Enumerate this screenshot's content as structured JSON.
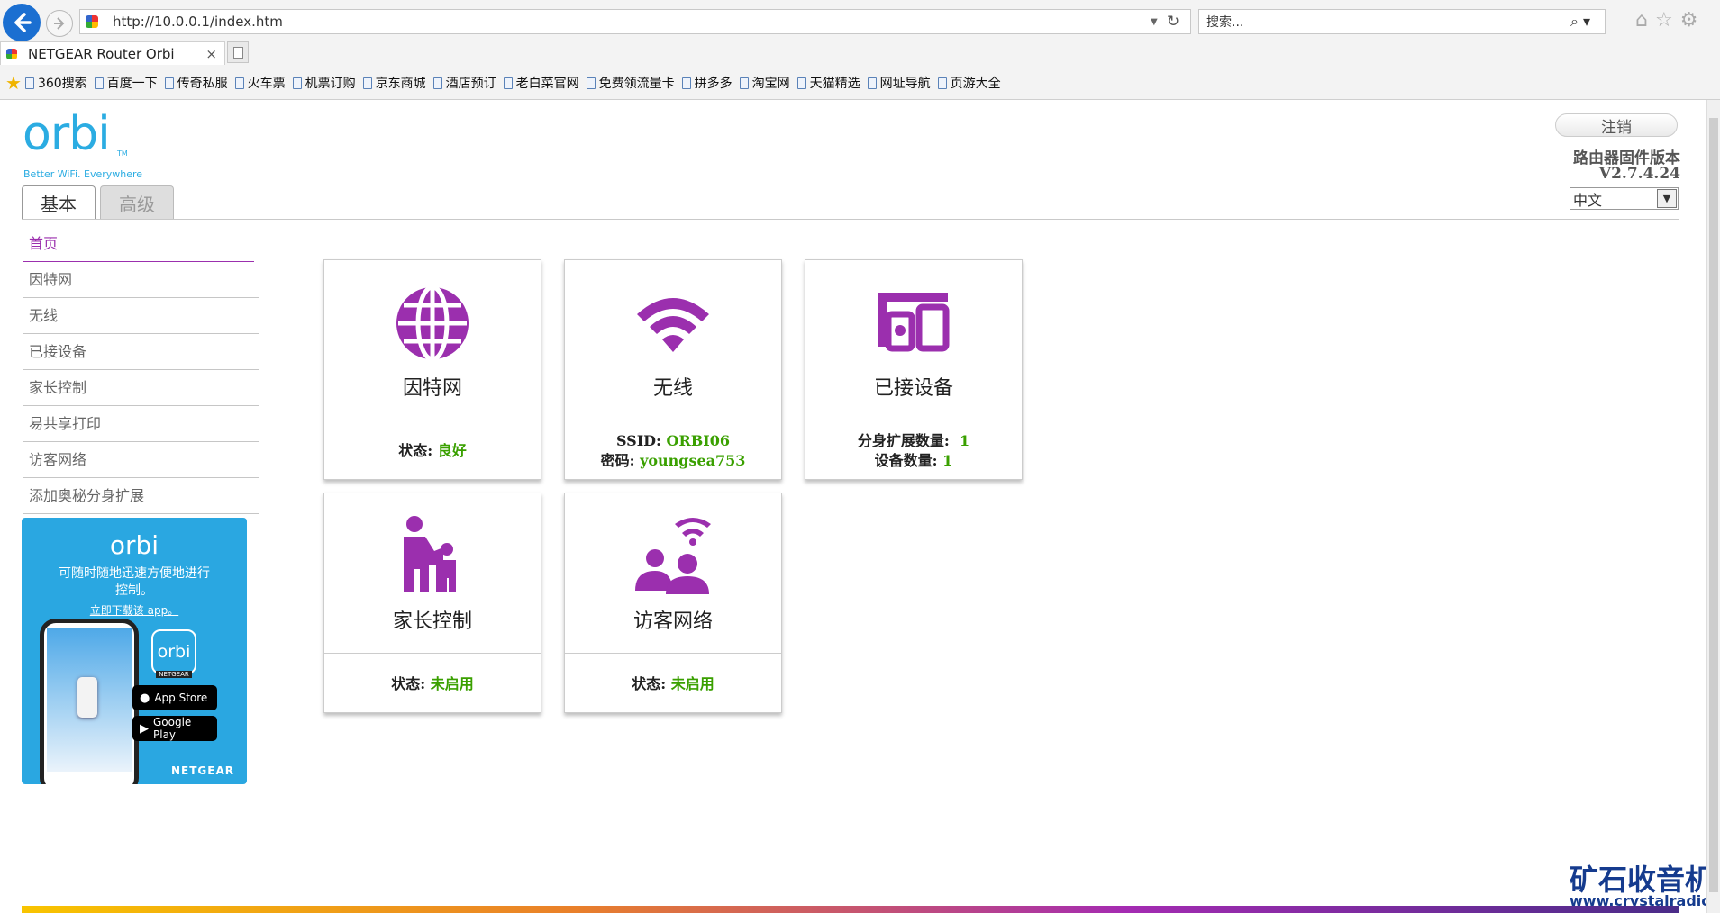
{
  "browser": {
    "url": "http://10.0.0.1/index.htm",
    "search_placeholder": "搜索...",
    "tab_title": "NETGEAR Router Orbi",
    "bookmarks": [
      "360搜索",
      "百度一下",
      "传奇私服",
      "火车票",
      "机票订购",
      "京东商城",
      "酒店预订",
      "老白菜官网",
      "免费领流量卡",
      "拼多多",
      "淘宝网",
      "天猫精选",
      "网址导航",
      "页游大全"
    ]
  },
  "header": {
    "logo": "orbi",
    "logo_tm": "TM",
    "tagline": "Better WiFi. Everywhere",
    "logout_label": "注销",
    "firmware_label": "路由器固件版本",
    "firmware_version": "V2.7.4.24",
    "language": "中文",
    "tabs": [
      "基本",
      "高级"
    ]
  },
  "sidebar": {
    "items": [
      "首页",
      "因特网",
      "无线",
      "已接设备",
      "家长控制",
      "易共享打印",
      "访客网络",
      "添加奥秘分身扩展"
    ]
  },
  "promo": {
    "logo": "orbi",
    "text": "可随时随地迅速方便地进行控制。",
    "link": "立即下载该 app。",
    "app_store": "App Store",
    "google_play": "Google Play",
    "brand": "NETGEAR"
  },
  "cards": {
    "internet": {
      "title": "因特网",
      "status_label": "状态:",
      "status_value": "良好"
    },
    "wireless": {
      "title": "无线",
      "ssid_label": "SSID:",
      "ssid_value": "ORBI06",
      "pwd_label": "密码:",
      "pwd_value": "youngsea753"
    },
    "devices": {
      "title": "已接设备",
      "sat_label": "分身扩展数量:",
      "sat_value": "1",
      "dev_label": "设备数量:",
      "dev_value": "1"
    },
    "parental": {
      "title": "家长控制",
      "status_label": "状态:",
      "status_value": "未启用"
    },
    "guest": {
      "title": "访客网络",
      "status_label": "状态:",
      "status_value": "未启用"
    }
  },
  "watermark": {
    "name": "矿石收音机",
    "url": "www.crystalradio.cn"
  },
  "colors": {
    "accent": "#9b2fae",
    "ok": "#3aa000",
    "orbi_blue": "#2bace2"
  }
}
